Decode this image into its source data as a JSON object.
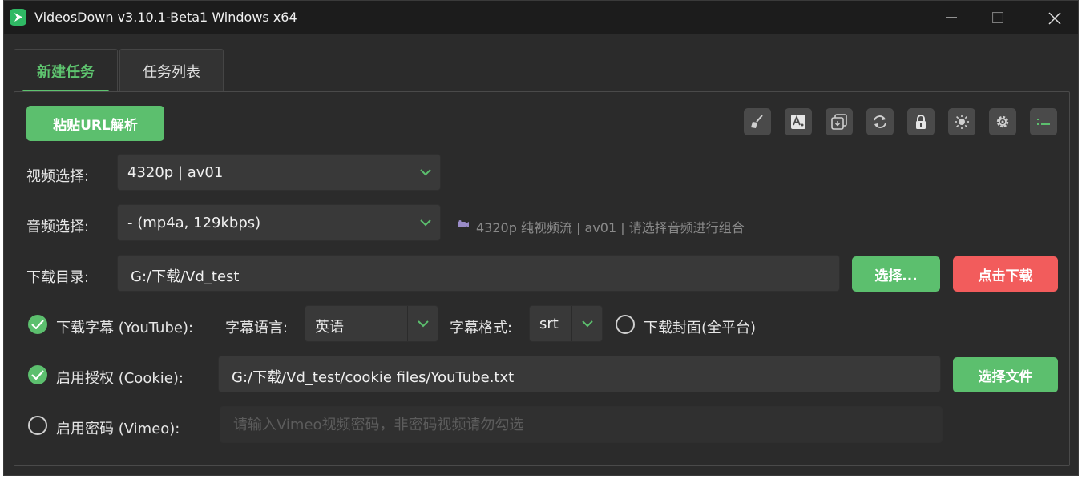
{
  "window": {
    "title": "VideosDown v3.10.1-Beta1 Windows x64",
    "accent": "#5cbf6e",
    "danger": "#f25c5c"
  },
  "tabs": [
    {
      "label": "新建任务",
      "active": true
    },
    {
      "label": "任务列表",
      "active": false
    }
  ],
  "toolbar": {
    "paste_label": "粘贴URL解析",
    "icons": [
      "broom-icon",
      "font-icon",
      "window-stack-icon",
      "refresh-icon",
      "lock-icon",
      "sun-icon",
      "gear-icon",
      "list-icon"
    ]
  },
  "video": {
    "label": "视频选择:",
    "value": "4320p | av01"
  },
  "audio": {
    "label": "音频选择:",
    "value": "- (mp4a, 129kbps)",
    "hint": "4320p 纯视频流 | av01 | 请选择音频进行组合"
  },
  "download_dir": {
    "label": "下载目录:",
    "value": "G:/下载/Vd_test",
    "choose_label": "选择...",
    "download_label": "点击下载"
  },
  "subtitle": {
    "checkbox_label": "下载字幕 (YouTube):",
    "checked": true,
    "lang_label": "字幕语言:",
    "lang_value": "英语",
    "format_label": "字幕格式:",
    "format_value": "srt",
    "cover_label": "下载封面(全平台)",
    "cover_checked": false
  },
  "cookie": {
    "checkbox_label": "启用授权 (Cookie):",
    "checked": true,
    "value": "G:/下载/Vd_test/cookie files/YouTube.txt",
    "choose_label": "选择文件"
  },
  "password": {
    "checkbox_label": "启用密码 (Vimeo):",
    "checked": false,
    "placeholder": "请输入Vimeo视频密码，非密码视频请勿勾选"
  }
}
